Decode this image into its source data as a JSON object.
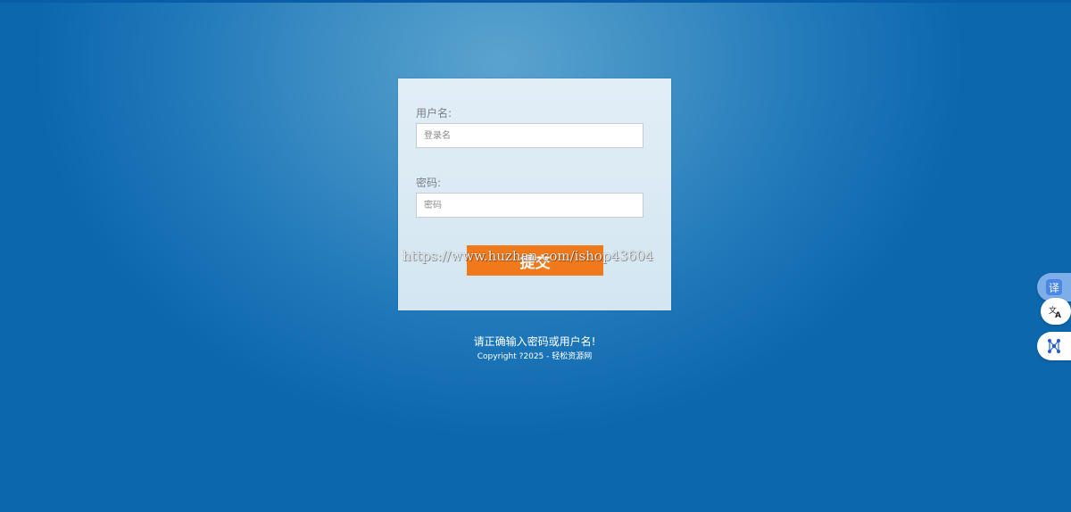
{
  "login": {
    "username_label": "用户名:",
    "username_placeholder": "登录名",
    "password_label": "密码:",
    "password_placeholder": "密码",
    "submit_label": "提交"
  },
  "watermark": "https://www.huzhan.com/ishop43604",
  "error_message": "请正确输入密码或用户名!",
  "copyright": "Copyright ?2025  -  轻松资源网",
  "side_toolbar": {
    "translate_badge": "译",
    "icons": [
      "translate-icon",
      "ocr-translate-icon",
      "ai-network-icon"
    ]
  },
  "colors": {
    "background": "#1f78b9",
    "panel": "#dceaf4",
    "submit": "#f07a1b"
  }
}
